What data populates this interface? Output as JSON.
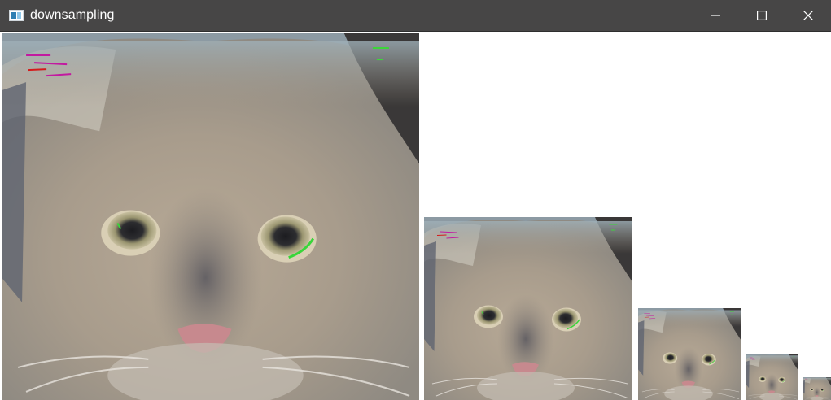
{
  "window": {
    "title": "downsampling",
    "app_icon": "opencv-window-icon",
    "controls": {
      "minimize_icon": "minimize-icon",
      "maximize_icon": "maximize-icon",
      "close_icon": "close-icon"
    }
  },
  "colors": {
    "titlebar_bg": "#474646",
    "titlebar_text": "#ffffff",
    "canvas_bg": "#ffffff",
    "fur": "#a89c8c",
    "shadow": "#6c6e76",
    "nose": "#c7898e"
  },
  "images": [
    {
      "level": 0,
      "subject": "cat-face"
    },
    {
      "level": 1,
      "subject": "cat-face"
    },
    {
      "level": 2,
      "subject": "cat-face"
    },
    {
      "level": 3,
      "subject": "cat-face"
    },
    {
      "level": 4,
      "subject": "cat-face"
    }
  ]
}
